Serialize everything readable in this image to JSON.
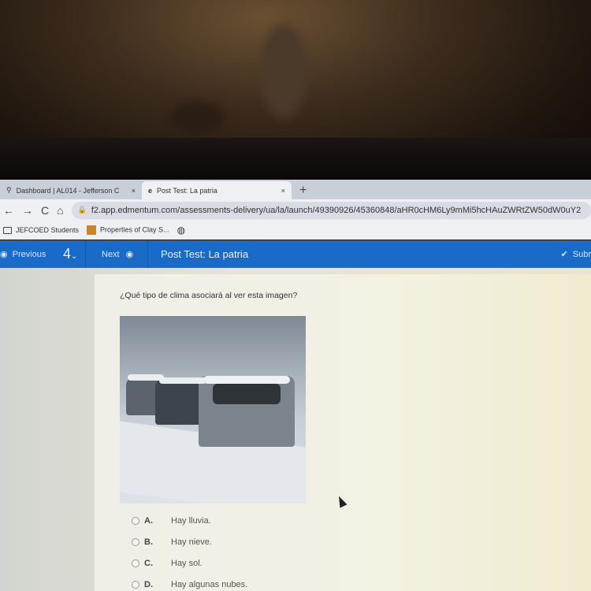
{
  "browser": {
    "tabs": [
      {
        "label": "Dashboard | AL014 - Jefferson C",
        "icon": "location-pin-icon",
        "active": false
      },
      {
        "label": "Post Test: La patria",
        "icon": "edmentum-e-icon",
        "active": true
      }
    ],
    "new_tab": "+",
    "close": "×",
    "url": "f2.app.edmentum.com/assessments-delivery/ua/la/launch/49390926/45360848/aHR0cHM6Ly9mMi5hcHAuZWRtZW50dW0uY2",
    "bookmarks": [
      {
        "label": "JEFCOED Students",
        "icon": "folder-icon"
      },
      {
        "label": "Properties of Clay S...",
        "icon": "bookmark-favicon"
      }
    ]
  },
  "toolbar": {
    "previous": "Previous",
    "question_number": "4",
    "next": "Next",
    "title": "Post Test: La patria",
    "submit": "Subr"
  },
  "question": {
    "prompt": "¿Qué tipo de clima asociará al ver esta imagen?",
    "image": "snowy-road-cars-photo",
    "options": [
      {
        "letter": "A.",
        "text": "Hay lluvia."
      },
      {
        "letter": "B.",
        "text": "Hay nieve."
      },
      {
        "letter": "C.",
        "text": "Hay sol."
      },
      {
        "letter": "D.",
        "text": "Hay algunas nubes."
      }
    ]
  },
  "colors": {
    "nav_bar": "#1a6bc8"
  }
}
